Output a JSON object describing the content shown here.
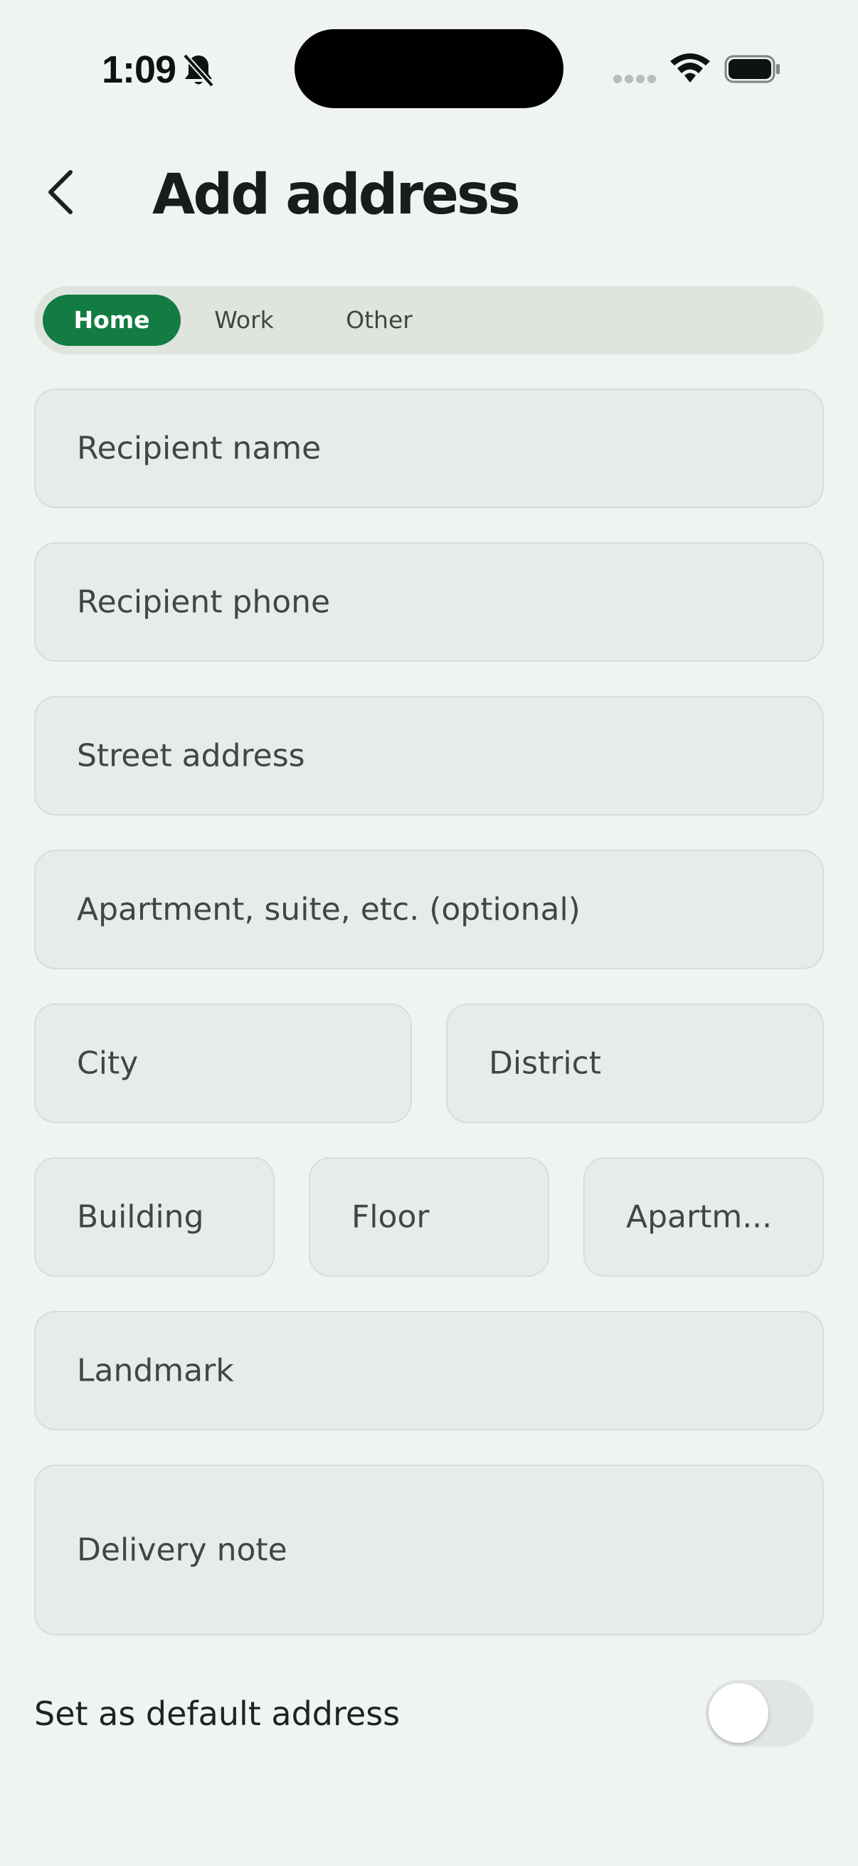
{
  "status_bar": {
    "time": "1:09",
    "icons": [
      "bell-off-icon",
      "cellular-signal-icon",
      "wifi-icon",
      "battery-icon"
    ]
  },
  "header": {
    "back_icon": "chevron-left-icon",
    "title": "Add address"
  },
  "address_type": {
    "options": [
      "Home",
      "Work",
      "Other"
    ],
    "selected": "Home",
    "active_color": "#137c42"
  },
  "form": {
    "recipient_name": {
      "placeholder": "Recipient name",
      "value": ""
    },
    "recipient_phone": {
      "placeholder": "Recipient phone",
      "value": ""
    },
    "street_address": {
      "placeholder": "Street address",
      "value": ""
    },
    "apartment_suite": {
      "placeholder": "Apartment, suite, etc. (optional)",
      "value": ""
    },
    "city": {
      "placeholder": "City",
      "value": ""
    },
    "district": {
      "placeholder": "District",
      "value": ""
    },
    "building": {
      "placeholder": "Building",
      "value": ""
    },
    "floor": {
      "placeholder": "Floor",
      "value": ""
    },
    "apartment": {
      "placeholder": "Apartm...",
      "value": ""
    },
    "landmark": {
      "placeholder": "Landmark",
      "value": ""
    },
    "delivery_note": {
      "placeholder": "Delivery note",
      "value": ""
    }
  },
  "default_address": {
    "label": "Set as default address",
    "enabled": false
  }
}
